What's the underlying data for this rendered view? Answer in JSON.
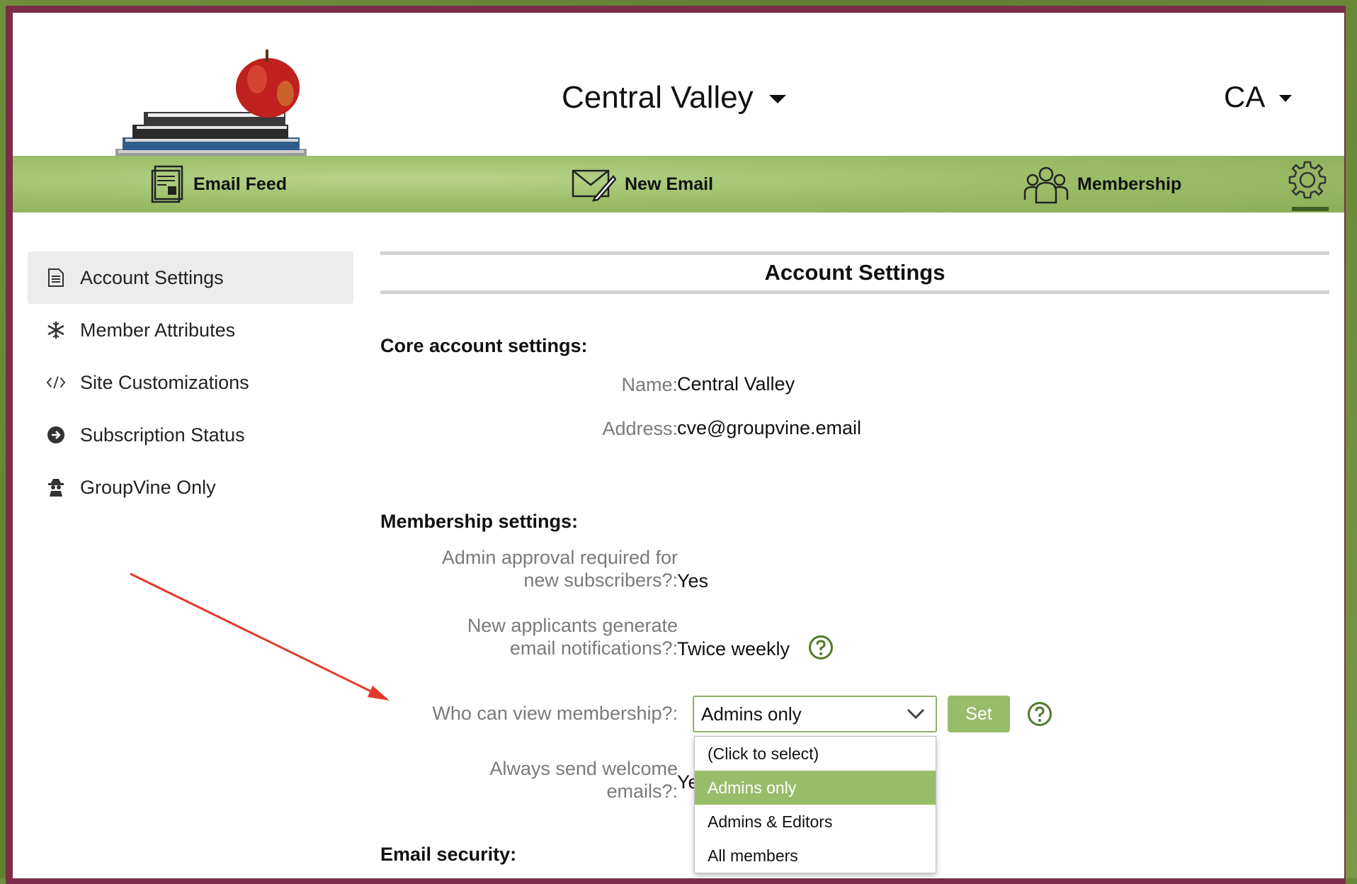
{
  "header": {
    "site_name": "Central Valley",
    "user_initials": "CA"
  },
  "nav": {
    "items": [
      {
        "label": "Email Feed",
        "icon": "email-feed-icon"
      },
      {
        "label": "New Email",
        "icon": "envelope-pen-icon"
      },
      {
        "label": "Membership",
        "icon": "people-icon"
      }
    ],
    "settings_icon": "gear-icon",
    "accent_color": "#98bd6a"
  },
  "sidebar": {
    "items": [
      {
        "label": "Account Settings",
        "icon": "document-icon",
        "active": true
      },
      {
        "label": "Member Attributes",
        "icon": "snowflake-icon"
      },
      {
        "label": "Site Customizations",
        "icon": "code-icon"
      },
      {
        "label": "Subscription Status",
        "icon": "arrow-circle-icon"
      },
      {
        "label": "GroupVine Only",
        "icon": "spy-icon"
      }
    ]
  },
  "main": {
    "title": "Account Settings",
    "core": {
      "heading": "Core account settings:",
      "name_label": "Name:",
      "name_value": "Central Valley",
      "address_label": "Address:",
      "address_value": "cve@groupvine.email"
    },
    "membership": {
      "heading": "Membership settings:",
      "approval_label_1": "Admin approval required for",
      "approval_label_2": "new subscribers?:",
      "approval_value": "Yes",
      "notify_label_1": "New applicants generate",
      "notify_label_2": "email notifications?:",
      "notify_value": "Twice weekly",
      "view_label": "Who can view membership?:",
      "view_selected": "Admins only",
      "set_button": "Set",
      "view_options": [
        "(Click to select)",
        "Admins only",
        "Admins & Editors",
        "All members"
      ],
      "welcome_label_1": "Always send welcome",
      "welcome_label_2": "emails?:",
      "welcome_value": "Ye"
    },
    "security": {
      "heading": "Email security:"
    }
  }
}
